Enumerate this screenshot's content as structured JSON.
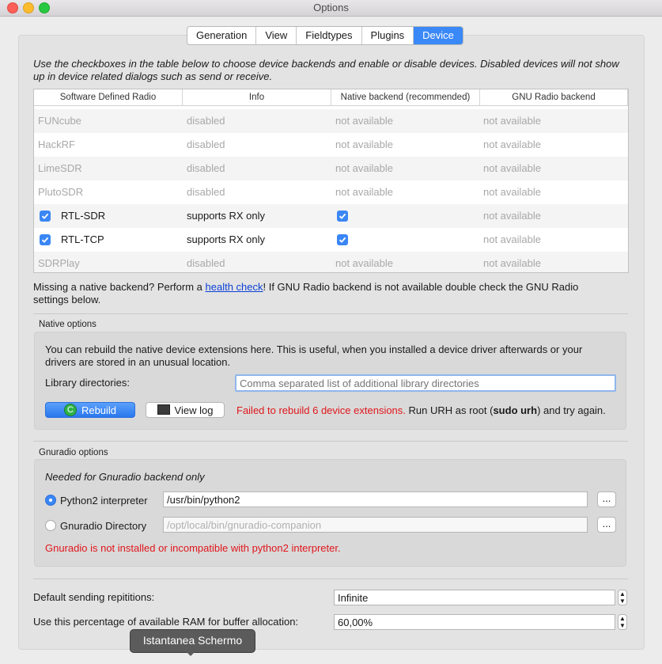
{
  "window": {
    "title": "Options"
  },
  "tabs": [
    {
      "label": "Generation"
    },
    {
      "label": "View"
    },
    {
      "label": "Fieldtypes"
    },
    {
      "label": "Plugins"
    },
    {
      "label": "Device",
      "active": true
    }
  ],
  "intro": "Use the checkboxes in the table below to choose device backends and enable or disable devices. Disabled devices will not show up in device related dialogs such as send or receive.",
  "table": {
    "headers": [
      "Software Defined Radio",
      "Info",
      "Native backend (recommended)",
      "GNU Radio backend"
    ],
    "rows": [
      {
        "name": "FUNcube",
        "info": "disabled",
        "native": "not available",
        "gnuradio": "not available",
        "enabled": false
      },
      {
        "name": "HackRF",
        "info": "disabled",
        "native": "not available",
        "gnuradio": "not available",
        "enabled": false
      },
      {
        "name": "LimeSDR",
        "info": "disabled",
        "native": "not available",
        "gnuradio": "not available",
        "enabled": false
      },
      {
        "name": "PlutoSDR",
        "info": "disabled",
        "native": "not available",
        "gnuradio": "not available",
        "enabled": false
      },
      {
        "name": "RTL-SDR",
        "info": "supports RX only",
        "native_checked": true,
        "gnuradio": "not available",
        "enabled": true
      },
      {
        "name": "RTL-TCP",
        "info": "supports RX only",
        "native_checked": true,
        "gnuradio": "not available",
        "enabled": true
      },
      {
        "name": "SDRPlay",
        "info": "disabled",
        "native": "not available",
        "gnuradio": "not available",
        "enabled": false
      }
    ]
  },
  "missing_backend": {
    "prefix": "Missing a native backend? Perform a ",
    "link": "health check",
    "suffix": "! If GNU Radio backend is not available double check the GNU Radio",
    "line2": "settings below."
  },
  "native_options": {
    "title": "Native options",
    "desc_line1": "You can rebuild the native device extensions here. This is useful, when you installed a device driver afterwards or your",
    "desc_line2": "drivers are stored in an unusual location.",
    "libdir_label": "Library directories:",
    "libdir_placeholder": "Comma separated list of additional library directories",
    "rebuild_label": "Rebuild",
    "viewlog_label": "View log",
    "status_error": "Failed to rebuild 6 device extensions.",
    "status_hint_pre": " Run URH as root (",
    "status_hint_cmd": "sudo urh",
    "status_hint_post": ") and try again."
  },
  "gnuradio_options": {
    "title": "Gnuradio options",
    "needed": "Needed for Gnuradio backend only",
    "python_label": "Python2 interpreter",
    "python_value": "/usr/bin/python2",
    "gnuradio_dir_label": "Gnuradio Directory",
    "gnuradio_dir_placeholder": "/opt/local/bin/gnuradio-companion",
    "browse_label": "...",
    "error": "Gnuradio is not installed or incompatible with python2 interpreter."
  },
  "settings": {
    "repetitions_label": "Default sending repititions:",
    "repetitions_value": "Infinite",
    "ram_label": "Use this percentage of available RAM for buffer allocation:",
    "ram_value": "60,00%"
  },
  "tooltip": "Istantanea Schermo",
  "colors": {
    "accent": "#3b89f6",
    "error": "#e0161b",
    "link": "#0b3fd6"
  }
}
